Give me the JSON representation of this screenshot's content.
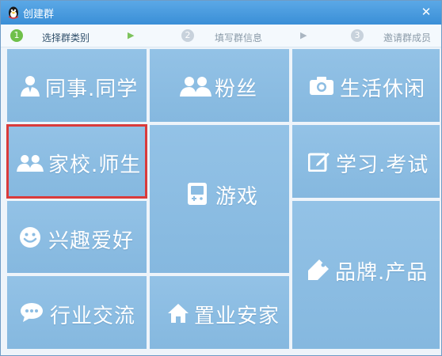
{
  "window": {
    "title": "创建群",
    "close_symbol": "✕"
  },
  "steps": [
    {
      "number": "1",
      "label": "选择群类别",
      "state": "active"
    },
    {
      "number": "2",
      "label": "填写群信息",
      "state": "inactive"
    },
    {
      "number": "3",
      "label": "邀请群成员",
      "state": "inactive"
    }
  ],
  "step_arrow": "▶",
  "categories": {
    "colleague": {
      "label": "同事.同学",
      "icon": "person-icon"
    },
    "fans": {
      "label": "粉丝",
      "icon": "group-icon"
    },
    "life": {
      "label": "生活休闲",
      "icon": "camera-icon"
    },
    "school": {
      "label": "家校.师生",
      "icon": "group-icon",
      "selected": true
    },
    "game": {
      "label": "游戏",
      "icon": "gamepad-icon"
    },
    "study": {
      "label": "学习.考试",
      "icon": "edit-icon"
    },
    "hobby": {
      "label": "兴趣爱好",
      "icon": "smiley-icon"
    },
    "brand": {
      "label": "品牌.产品",
      "icon": "tag-icon"
    },
    "industry": {
      "label": "行业交流",
      "icon": "chat-icon"
    },
    "realestate": {
      "label": "置业安家",
      "icon": "house-icon"
    }
  },
  "colors": {
    "accent": "#3a8fd7",
    "tile": "#8cbde3",
    "active_step": "#6fc04a",
    "inactive_step": "#c8d2dc",
    "selection": "#d93b3b"
  }
}
